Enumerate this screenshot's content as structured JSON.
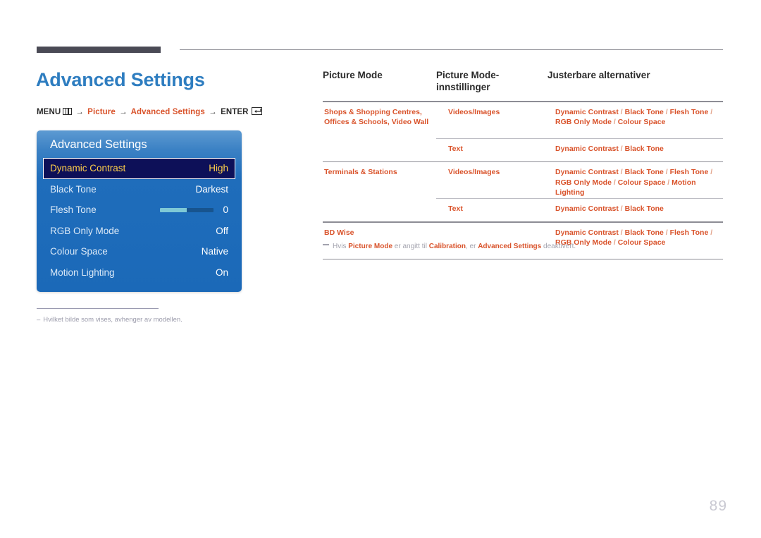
{
  "page": {
    "number": "89",
    "title": "Advanced Settings"
  },
  "breadcrumb": {
    "menu_label": "MENU",
    "menu_icon": "menu-bars-icon",
    "arrow": "→",
    "step1": "Picture",
    "step2": "Advanced Settings",
    "enter_label": "ENTER",
    "enter_icon": "enter-return-icon"
  },
  "osd": {
    "title": "Advanced Settings",
    "rows": [
      {
        "label": "Dynamic Contrast",
        "value": "High",
        "selected": true,
        "type": "value"
      },
      {
        "label": "Black Tone",
        "value": "Darkest",
        "selected": false,
        "type": "value"
      },
      {
        "label": "Flesh Tone",
        "value": "0",
        "selected": false,
        "type": "slider",
        "slider_percent": 50
      },
      {
        "label": "RGB Only Mode",
        "value": "Off",
        "selected": false,
        "type": "value"
      },
      {
        "label": "Colour Space",
        "value": "Native",
        "selected": false,
        "type": "value"
      },
      {
        "label": "Motion Lighting",
        "value": "On",
        "selected": false,
        "type": "value"
      }
    ]
  },
  "left_note": {
    "dash": "–",
    "text": "Hvilket bilde som vises, avhenger av modellen."
  },
  "table": {
    "headers": [
      "Picture Mode",
      "Picture Mode-\ninnstillinger",
      "Justerbare alternativer"
    ],
    "header1": "Picture Mode",
    "header2_line1": "Picture Mode-",
    "header2_line2": "innstillinger",
    "header3": "Justerbare alternativer",
    "rows": [
      {
        "mode": "Shops & Shopping Centres, Offices & Schools, Video Wall",
        "setting": "Videos/Images",
        "options": "Dynamic Contrast / Black Tone / Flesh Tone / RGB Only Mode / Colour Space"
      },
      {
        "mode": "",
        "setting": "Text",
        "options": "Dynamic Contrast / Black Tone"
      },
      {
        "mode": "Terminals & Stations",
        "setting": "Videos/Images",
        "options": "Dynamic Contrast / Black Tone / Flesh Tone / RGB Only Mode / Colour Space / Motion Lighting"
      },
      {
        "mode": "",
        "setting": "Text",
        "options": "Dynamic Contrast / Black Tone"
      },
      {
        "mode": "BD Wise",
        "setting": "",
        "options": "Dynamic Contrast / Black Tone / Flesh Tone / RGB Only Mode / Colour Space"
      }
    ]
  },
  "right_note": {
    "prefix": "Hvis ",
    "bold1": "Picture Mode",
    "mid1": " er angitt til ",
    "bold2": "Calibration",
    "mid2": ", er ",
    "bold3": "Advanced Settings",
    "suffix": " deaktivert."
  },
  "colors": {
    "title_blue": "#2e7dc0",
    "accent_orange": "#d9532b",
    "osd_blue": "#1b69b8",
    "osd_selected_bg": "#0d1058",
    "osd_selected_text": "#ffd04a",
    "note_gray": "#a3a3ae"
  }
}
